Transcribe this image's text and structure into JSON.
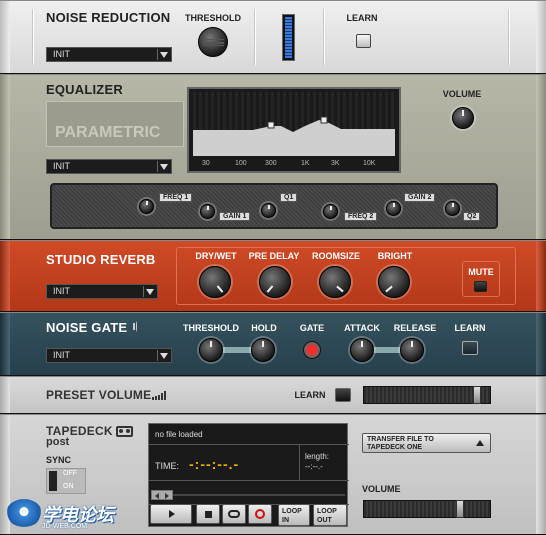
{
  "noise_reduction": {
    "title": "NOISE REDUCTION",
    "threshold_label": "THRESHOLD",
    "learn_label": "LEARN",
    "preset": "INIT"
  },
  "equalizer": {
    "title": "EQUALIZER",
    "mode": "PARAMETRIC",
    "preset": "INIT",
    "volume_label": "VOLUME",
    "freq_ticks": [
      "30",
      "100",
      "300",
      "1K",
      "3K",
      "10K"
    ],
    "band_labels": {
      "freq1": "FREQ 1",
      "gain1": "GAIN 1",
      "q1": "Q1",
      "freq2": "FREQ 2",
      "gain2": "GAIN 2",
      "q2": "Q2"
    }
  },
  "studio_reverb": {
    "title": "STUDIO REVERB",
    "preset": "INIT",
    "knobs": [
      "DRY/WET",
      "PRE DELAY",
      "ROOMSIZE",
      "BRIGHT"
    ],
    "mute_label": "MUTE"
  },
  "noise_gate": {
    "title": "NOISE GATE",
    "preset": "INIT",
    "threshold_label": "THRESHOLD",
    "hold_label": "HOLD",
    "gate_label": "GATE",
    "attack_label": "ATTACK",
    "release_label": "RELEASE",
    "learn_label": "LEARN"
  },
  "preset_volume": {
    "title": "PRESET VOLUME",
    "learn_label": "LEARN"
  },
  "tapedeck": {
    "title": "TAPEDECK",
    "subtitle": "post",
    "sync_label": "SYNC",
    "sync_off": "OFF",
    "sync_on": "ON",
    "file_status": "no file loaded",
    "time_label": "TIME:",
    "time_value": "-:--:--.-",
    "length_label": "length:",
    "length_value": "--:--.-",
    "transfer_label_1": "TRANSFER FILE TO",
    "transfer_label_2": "TAPEDECK ONE",
    "volume_label": "VOLUME",
    "loop_in_1": "LOOP",
    "loop_in_2": "IN",
    "loop_out_1": "LOOP",
    "loop_out_2": "OUT"
  },
  "watermark": {
    "text": "学电论坛",
    "url": "JD-WEB.COM"
  },
  "colors": {
    "reverb_bg": "#c0401e",
    "gate_bg": "#2e4b5a",
    "eq_bg": "#a8a898",
    "nr_bg": "#e4e4e4",
    "gate_led": "#ff2a2a",
    "eq_curve": "#cfcfcf",
    "meter_blue": "#3a7ad8"
  }
}
